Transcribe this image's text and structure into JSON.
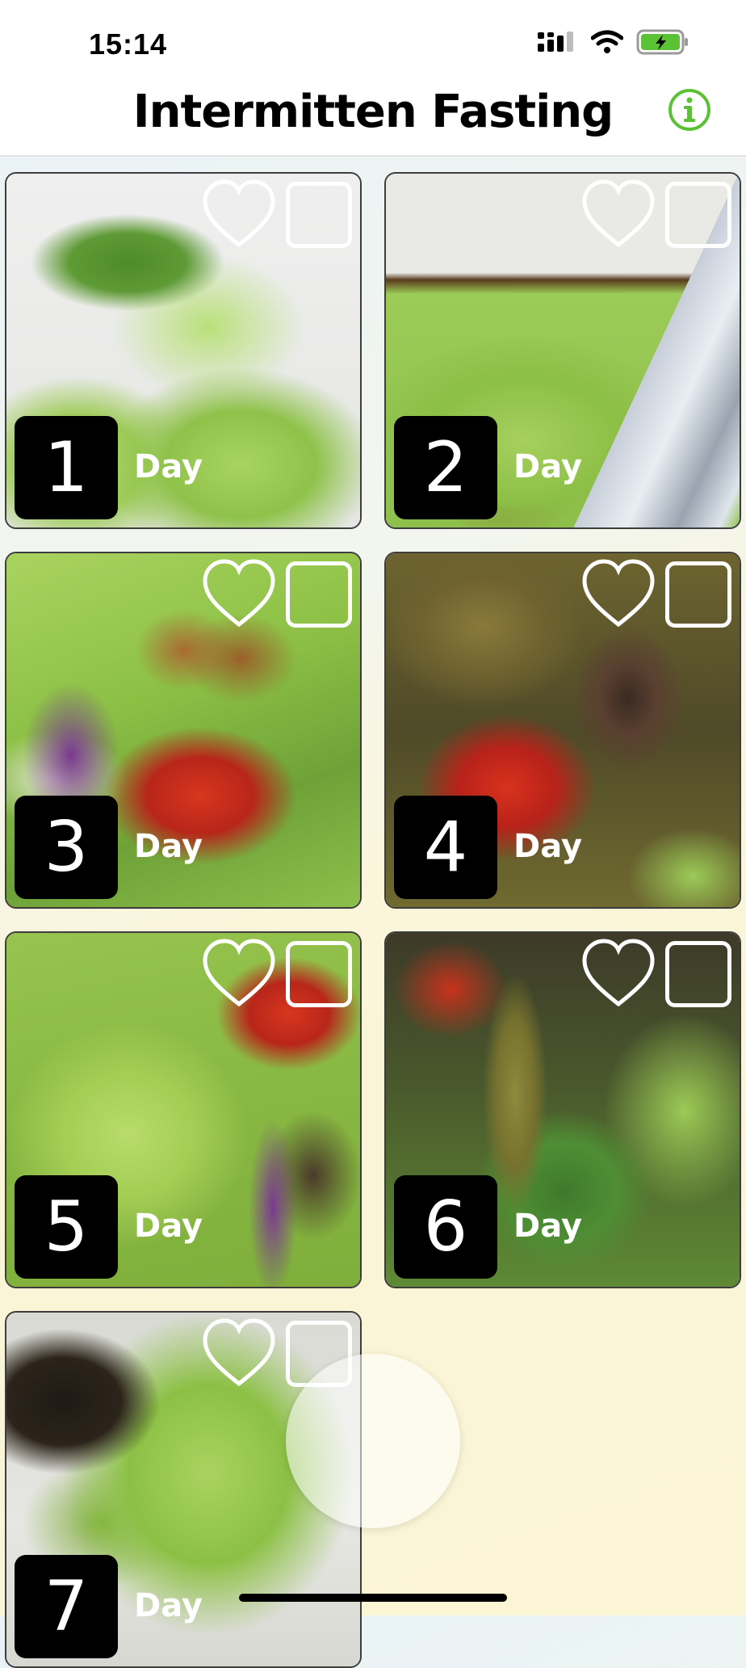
{
  "status": {
    "time": "15:14"
  },
  "nav": {
    "title": "Intermitten Fasting"
  },
  "colors": {
    "accent": "#5bc236",
    "badge": "#000000"
  },
  "icons": {
    "info": "info-icon",
    "heart": "heart-icon",
    "checkbox": "checkbox-icon"
  },
  "days": [
    {
      "number": "1",
      "label": "Day"
    },
    {
      "number": "2",
      "label": "Day"
    },
    {
      "number": "3",
      "label": "Day"
    },
    {
      "number": "4",
      "label": "Day"
    },
    {
      "number": "5",
      "label": "Day"
    },
    {
      "number": "6",
      "label": "Day"
    },
    {
      "number": "7",
      "label": "Day"
    }
  ]
}
